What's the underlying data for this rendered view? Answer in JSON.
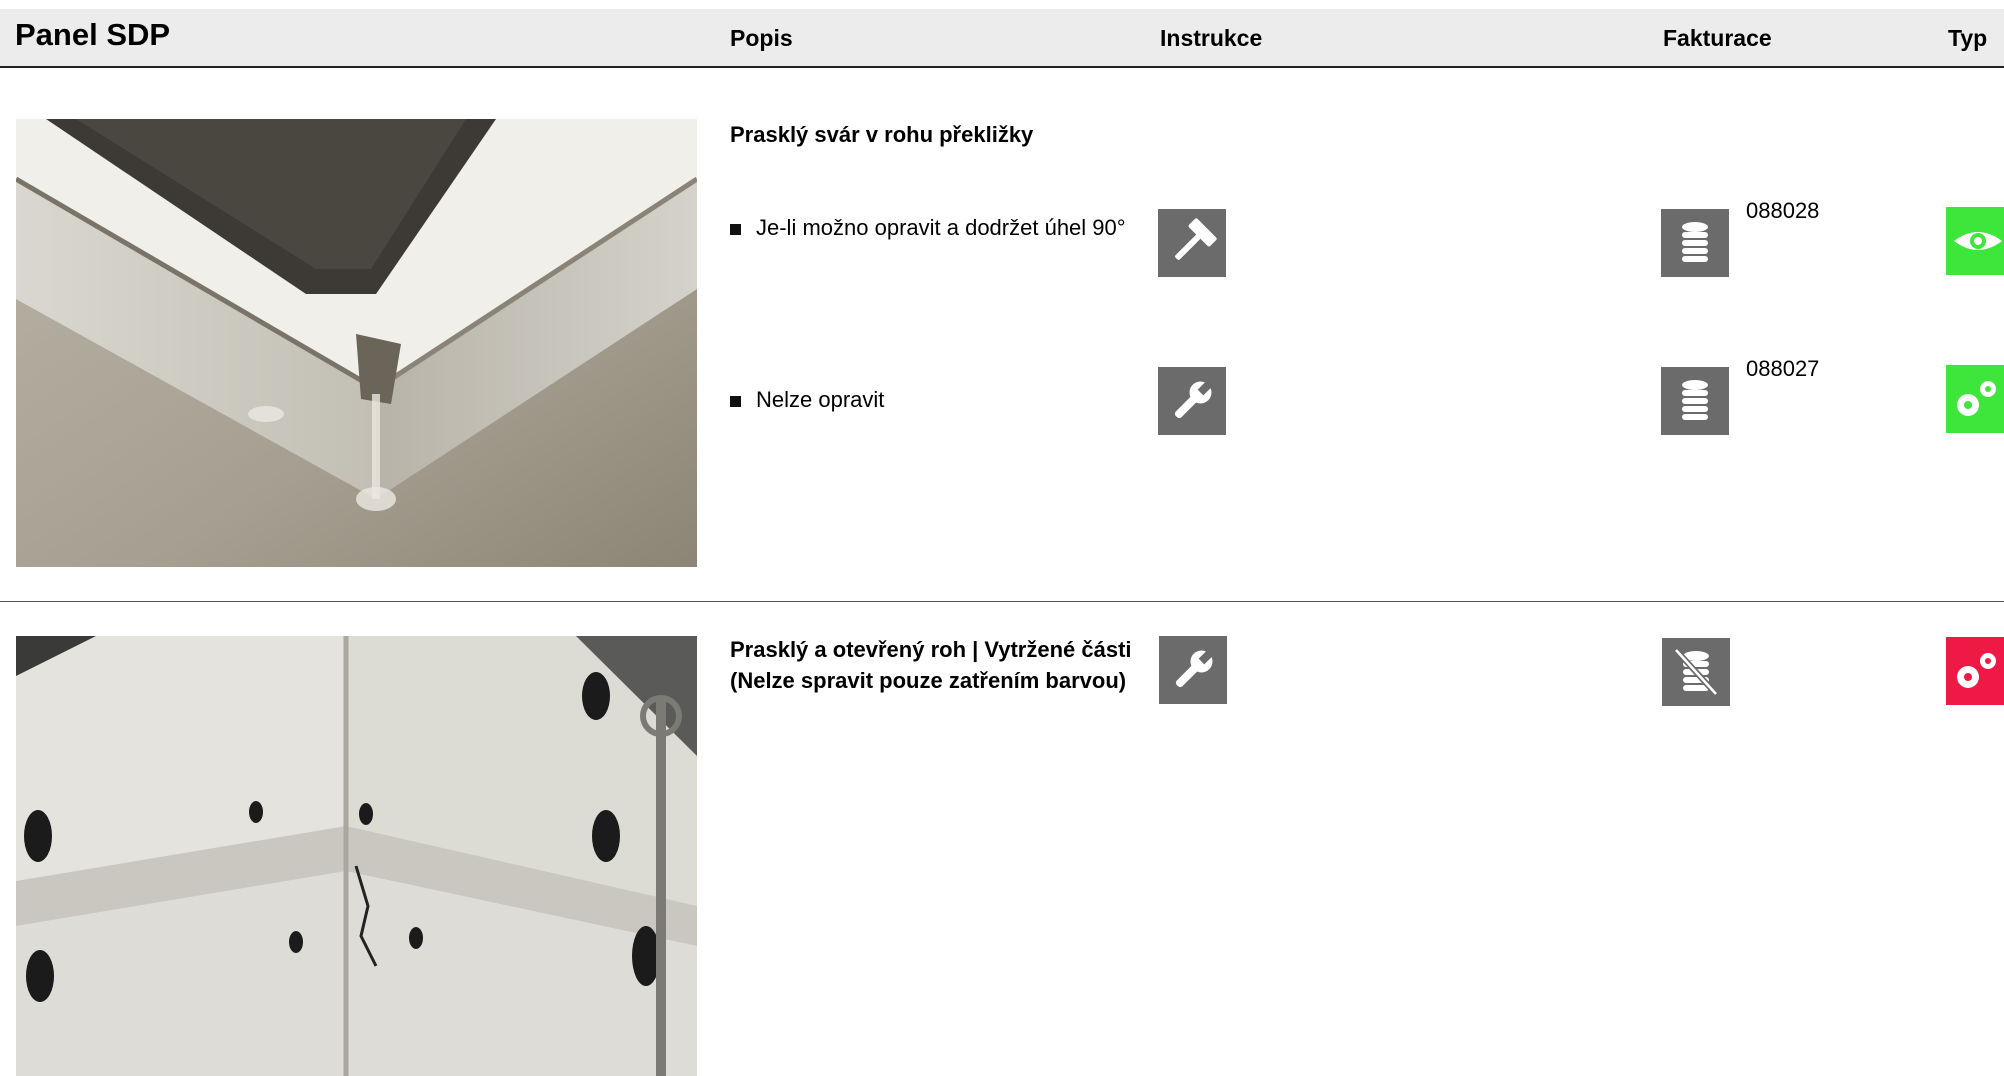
{
  "header": {
    "title": "Panel SDP",
    "columns": {
      "popis": "Popis",
      "instrukce": "Instrukce",
      "fakturace": "Fakturace",
      "typ": "Typ"
    }
  },
  "rows": [
    {
      "heading": "Prasklý svár v rohu překližky",
      "items": [
        {
          "text": "Je-li možno opravit a dodržet úhel 90°",
          "instruction_icon": "hammer-icon",
          "billing_icon": "coins-icon",
          "code": "088028",
          "type_icon": "eye-icon",
          "type_color": "#3ee63b"
        },
        {
          "text": "Nelze opravit",
          "instruction_icon": "wrench-icon",
          "billing_icon": "coins-icon",
          "code": "088027",
          "type_icon": "gears-icon",
          "type_color": "#3ee63b"
        }
      ]
    },
    {
      "heading": "Prasklý a otevřený roh |  Vytržené části (Nelze spravit pouze zatřením barvou)",
      "instruction_icon": "wrench-icon",
      "billing_icon": "no-coins-icon",
      "type_icon": "gears-icon",
      "type_color": "#ee1a45"
    }
  ],
  "colors": {
    "icon_gray": "#6b6b6b",
    "type_green": "#3ee63b",
    "type_red": "#ee1a45",
    "header_bg": "#ececec"
  }
}
